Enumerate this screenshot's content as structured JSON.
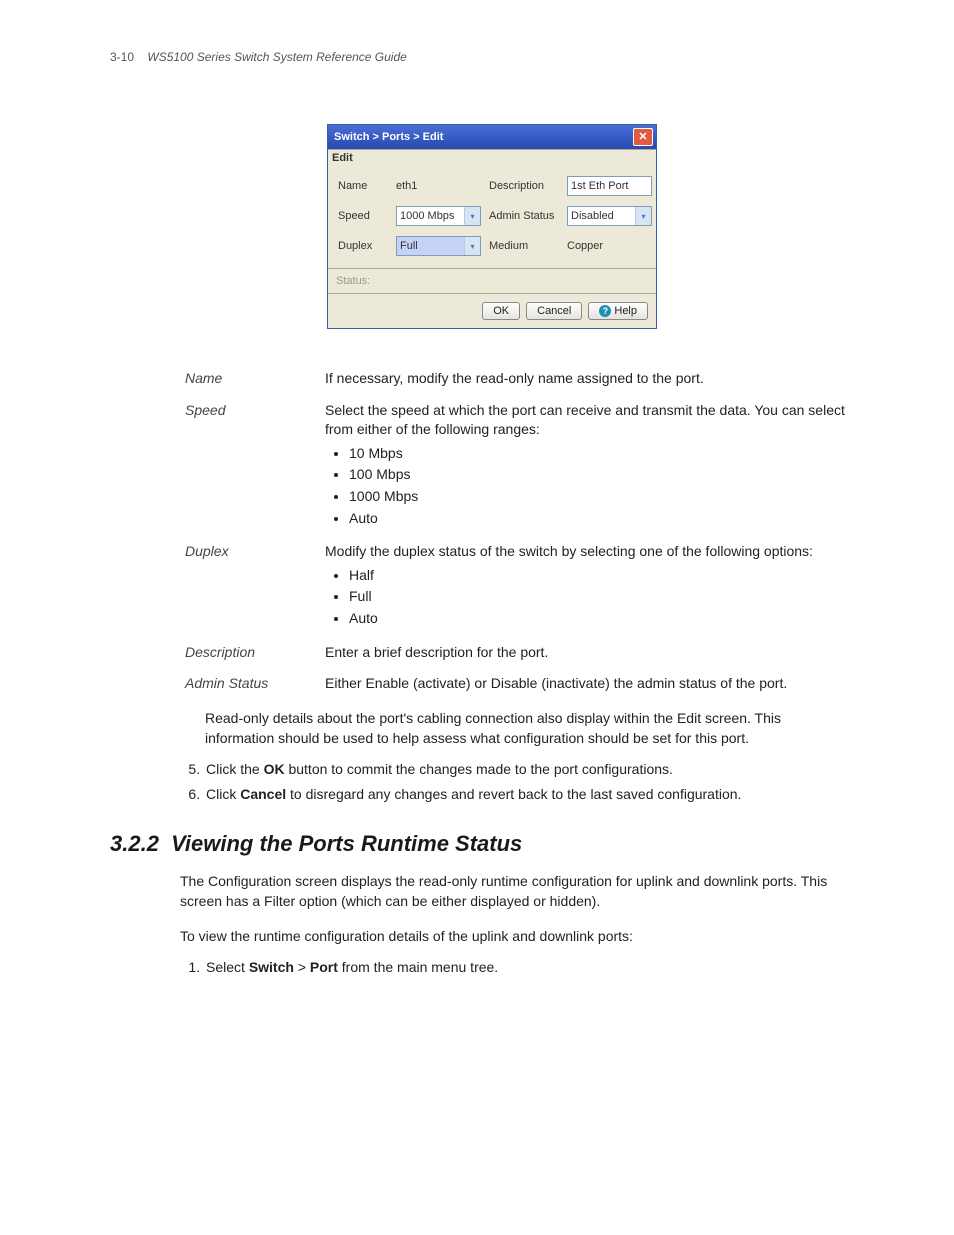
{
  "header": {
    "page_number": "3-10",
    "guide_title": "WS5100 Series Switch System Reference Guide"
  },
  "dialog": {
    "title": "Switch > Ports > Edit",
    "subtitle": "Edit",
    "fields": {
      "name_label": "Name",
      "name_value": "eth1",
      "description_label": "Description",
      "description_value": "1st Eth Port",
      "speed_label": "Speed",
      "speed_value": "1000 Mbps",
      "admin_status_label": "Admin Status",
      "admin_status_value": "Disabled",
      "duplex_label": "Duplex",
      "duplex_value": "Full",
      "medium_label": "Medium",
      "medium_value": "Copper"
    },
    "status_label": "Status:",
    "buttons": {
      "ok": "OK",
      "cancel": "Cancel",
      "help": "Help"
    }
  },
  "definitions": {
    "name": {
      "term": "Name",
      "desc": "If necessary, modify the read-only name assigned to the port."
    },
    "speed": {
      "term": "Speed",
      "desc": "Select the speed at which the port can receive and transmit the data. You can select from either of the following ranges:",
      "items": [
        "10 Mbps",
        "100 Mbps",
        "1000 Mbps",
        "Auto"
      ]
    },
    "duplex": {
      "term": "Duplex",
      "desc": "Modify the duplex status of the switch by selecting one of the following options:",
      "items": [
        "Half",
        "Full",
        "Auto"
      ]
    },
    "description": {
      "term": "Description",
      "desc": "Enter a brief description for the port."
    },
    "admin_status": {
      "term": "Admin Status",
      "desc": "Either Enable (activate) or Disable (inactivate) the admin status of the port."
    }
  },
  "text": {
    "readonly_note": "Read-only details about the port's cabling connection also display within the Edit screen. This information should be used to help assess what configuration should be set for this port.",
    "step5_pre": "Click the ",
    "step5_bold": "OK",
    "step5_post": " button to commit the changes made to the port configurations.",
    "step6_pre": "Click ",
    "step6_bold": "Cancel",
    "step6_post": " to disregard any changes and revert back to the last saved configuration."
  },
  "section": {
    "number": "3.2.2",
    "title": "Viewing the Ports Runtime Status",
    "p1": "The Configuration screen displays the read-only runtime configuration for uplink and downlink ports. This screen has a Filter option (which can be either displayed or hidden).",
    "p2": "To view the runtime configuration details of the uplink and downlink ports:",
    "step1_pre": "Select ",
    "step1_b1": "Switch",
    "step1_gt": " > ",
    "step1_b2": "Port",
    "step1_post": " from the main menu tree."
  }
}
